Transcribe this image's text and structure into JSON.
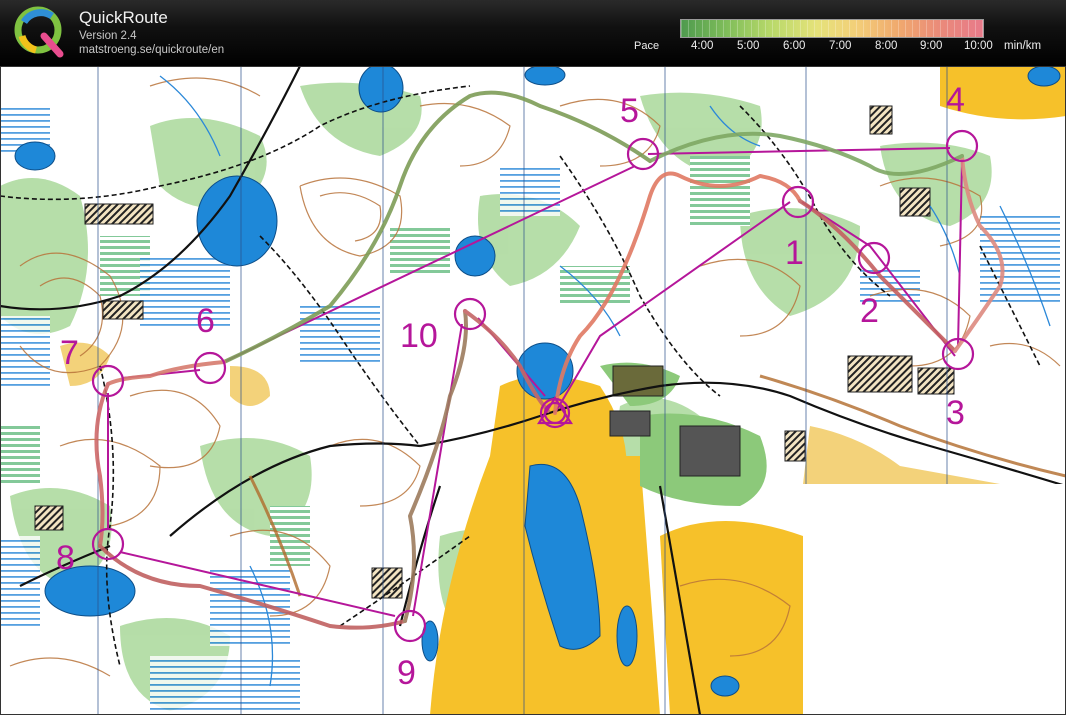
{
  "app": {
    "title": "QuickRoute",
    "version": "Version 2.4",
    "url": "matstroeng.se/quickroute/en"
  },
  "pace_scale": {
    "label": "Pace",
    "ticks": [
      "4:00",
      "5:00",
      "6:00",
      "7:00",
      "8:00",
      "9:00",
      "10:00"
    ],
    "unit": "min/km"
  },
  "map": {
    "control_labels": [
      "1",
      "2",
      "3",
      "4",
      "5",
      "6",
      "7",
      "8",
      "9",
      "10"
    ],
    "colors": {
      "course": "#b5169a",
      "route": "#c0392b",
      "water": "#1e88d8",
      "open_land": "#f6c12a",
      "forest_green": "#8cc97a"
    }
  }
}
